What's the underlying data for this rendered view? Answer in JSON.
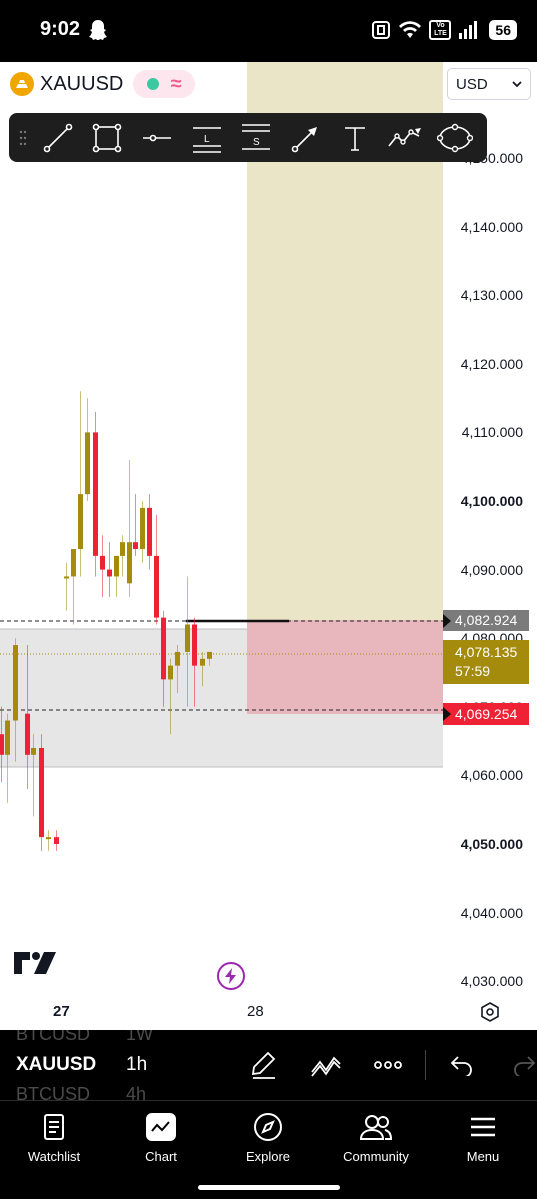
{
  "status_bar": {
    "time": "9:02",
    "volte": "Vo LTE",
    "battery": "56"
  },
  "symbol": {
    "name": "XAUUSD",
    "currency": "USD"
  },
  "toolbar": {
    "tools": [
      "trend-line-icon",
      "rectangle-icon",
      "horizontal-line-icon",
      "long-position-icon",
      "short-position-icon",
      "arrow-icon",
      "text-icon",
      "path-icon",
      "ellipse-icon"
    ],
    "long_letter": "L",
    "short_letter": "S"
  },
  "price_axis": {
    "labels": [
      "4,150.000",
      "4,140.000",
      "4,130.000",
      "4,120.000",
      "4,110.000",
      "4,100.000",
      "4,090.000",
      "4,080.000",
      "4,070.000",
      "4,060.000",
      "4,050.000",
      "4,040.000",
      "4,030.000"
    ],
    "bold": [
      "4,100.000",
      "4,050.000"
    ]
  },
  "price_tags": {
    "level_high": "4,082.924",
    "current": "4,078.135",
    "countdown": "57:59",
    "level_low": "4,069.254"
  },
  "time_axis": {
    "labels": [
      "27",
      "28"
    ]
  },
  "chart_data": {
    "type": "candlestick",
    "colors": {
      "up": "#a48b0c",
      "down": "#ef2235"
    },
    "candles": [
      {
        "o": 4066,
        "h": 4070,
        "l": 4059,
        "c": 4063
      },
      {
        "o": 4063,
        "h": 4069,
        "l": 4056,
        "c": 4068
      },
      {
        "o": 4068,
        "h": 4080,
        "l": 4062,
        "c": 4079
      },
      {
        "o": 4069,
        "h": 4079,
        "l": 4058,
        "c": 4063
      },
      {
        "o": 4063,
        "h": 4066,
        "l": 4054,
        "c": 4064
      },
      {
        "o": 4064,
        "h": 4066,
        "l": 4049,
        "c": 4051
      },
      {
        "o": 4051,
        "h": 4052,
        "l": 4049,
        "c": 4051
      },
      {
        "o": 4051,
        "h": 4052,
        "l": 4049,
        "c": 4050
      },
      {
        "o": 4089,
        "h": 4091,
        "l": 4084,
        "c": 4089
      },
      {
        "o": 4089,
        "h": 4091,
        "l": 4082,
        "c": 4093
      },
      {
        "o": 4093,
        "h": 4116,
        "l": 4089,
        "c": 4101
      },
      {
        "o": 4101,
        "h": 4115,
        "l": 4100,
        "c": 4110
      },
      {
        "o": 4110,
        "h": 4113,
        "l": 4089,
        "c": 4092
      },
      {
        "o": 4092,
        "h": 4095,
        "l": 4086,
        "c": 4090
      },
      {
        "o": 4090,
        "h": 4094,
        "l": 4086,
        "c": 4089
      },
      {
        "o": 4089,
        "h": 4092,
        "l": 4086,
        "c": 4092
      },
      {
        "o": 4092,
        "h": 4095,
        "l": 4089,
        "c": 4094
      },
      {
        "o": 4088,
        "h": 4106,
        "l": 4086,
        "c": 4094
      },
      {
        "o": 4094,
        "h": 4101,
        "l": 4092,
        "c": 4093
      },
      {
        "o": 4093,
        "h": 4100,
        "l": 4091,
        "c": 4099
      },
      {
        "o": 4099,
        "h": 4101,
        "l": 4090,
        "c": 4092
      },
      {
        "o": 4092,
        "h": 4098,
        "l": 4082,
        "c": 4083
      },
      {
        "o": 4083,
        "h": 4084,
        "l": 4070,
        "c": 4074
      },
      {
        "o": 4074,
        "h": 4077,
        "l": 4066,
        "c": 4076
      },
      {
        "o": 4076,
        "h": 4079,
        "l": 4072,
        "c": 4078
      },
      {
        "o": 4078,
        "h": 4089,
        "l": 4070,
        "c": 4082
      },
      {
        "o": 4082,
        "h": 4083,
        "l": 4070,
        "c": 4076
      },
      {
        "o": 4076,
        "h": 4078,
        "l": 4073,
        "c": 4077
      },
      {
        "o": 4077,
        "h": 4078,
        "l": 4076,
        "c": 4078
      }
    ]
  },
  "controls": {
    "ghost_above": [
      "BTCUSD",
      "1W"
    ],
    "symbol": "XAUUSD",
    "interval": "1h",
    "ghost_below": [
      "BTCUSD",
      "4h"
    ]
  },
  "nav": {
    "items": [
      "Watchlist",
      "Chart",
      "Explore",
      "Community",
      "Menu"
    ]
  }
}
